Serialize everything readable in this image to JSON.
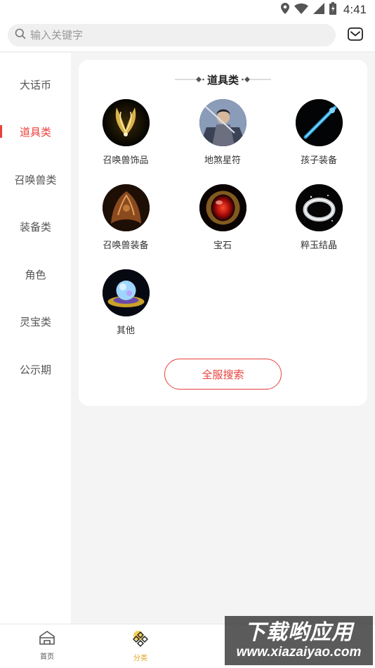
{
  "status_bar": {
    "time": "4:41"
  },
  "search": {
    "placeholder": "输入关键字"
  },
  "sidebar": {
    "items": [
      {
        "label": "大话币",
        "active": false
      },
      {
        "label": "道具类",
        "active": true
      },
      {
        "label": "召唤兽类",
        "active": false
      },
      {
        "label": "装备类",
        "active": false
      },
      {
        "label": "角色",
        "active": false
      },
      {
        "label": "灵宝类",
        "active": false
      },
      {
        "label": "公示期",
        "active": false
      }
    ]
  },
  "content": {
    "title": "道具类",
    "items": [
      {
        "label": "召唤兽饰品",
        "icon": "golden-wings-icon"
      },
      {
        "label": "地煞星符",
        "icon": "warrior-portrait-icon"
      },
      {
        "label": "孩子装备",
        "icon": "blue-staff-icon"
      },
      {
        "label": "召唤兽装备",
        "icon": "bronze-armor-icon"
      },
      {
        "label": "宝石",
        "icon": "red-gem-icon"
      },
      {
        "label": "粹玉结晶",
        "icon": "jade-ring-icon"
      },
      {
        "label": "其他",
        "icon": "crystal-orb-icon"
      }
    ],
    "search_all_label": "全服搜索"
  },
  "bottom_nav": {
    "items": [
      {
        "label": "首页",
        "icon": "home-icon",
        "active": false
      },
      {
        "label": "分类",
        "icon": "category-icon",
        "active": true
      }
    ]
  },
  "watermark": {
    "line1": "下载哟应用",
    "line2": "www.xiazaiyao.com"
  },
  "colors": {
    "accent": "#e8413b",
    "nav_active": "#e2a522",
    "background": "#f4f4f4"
  }
}
